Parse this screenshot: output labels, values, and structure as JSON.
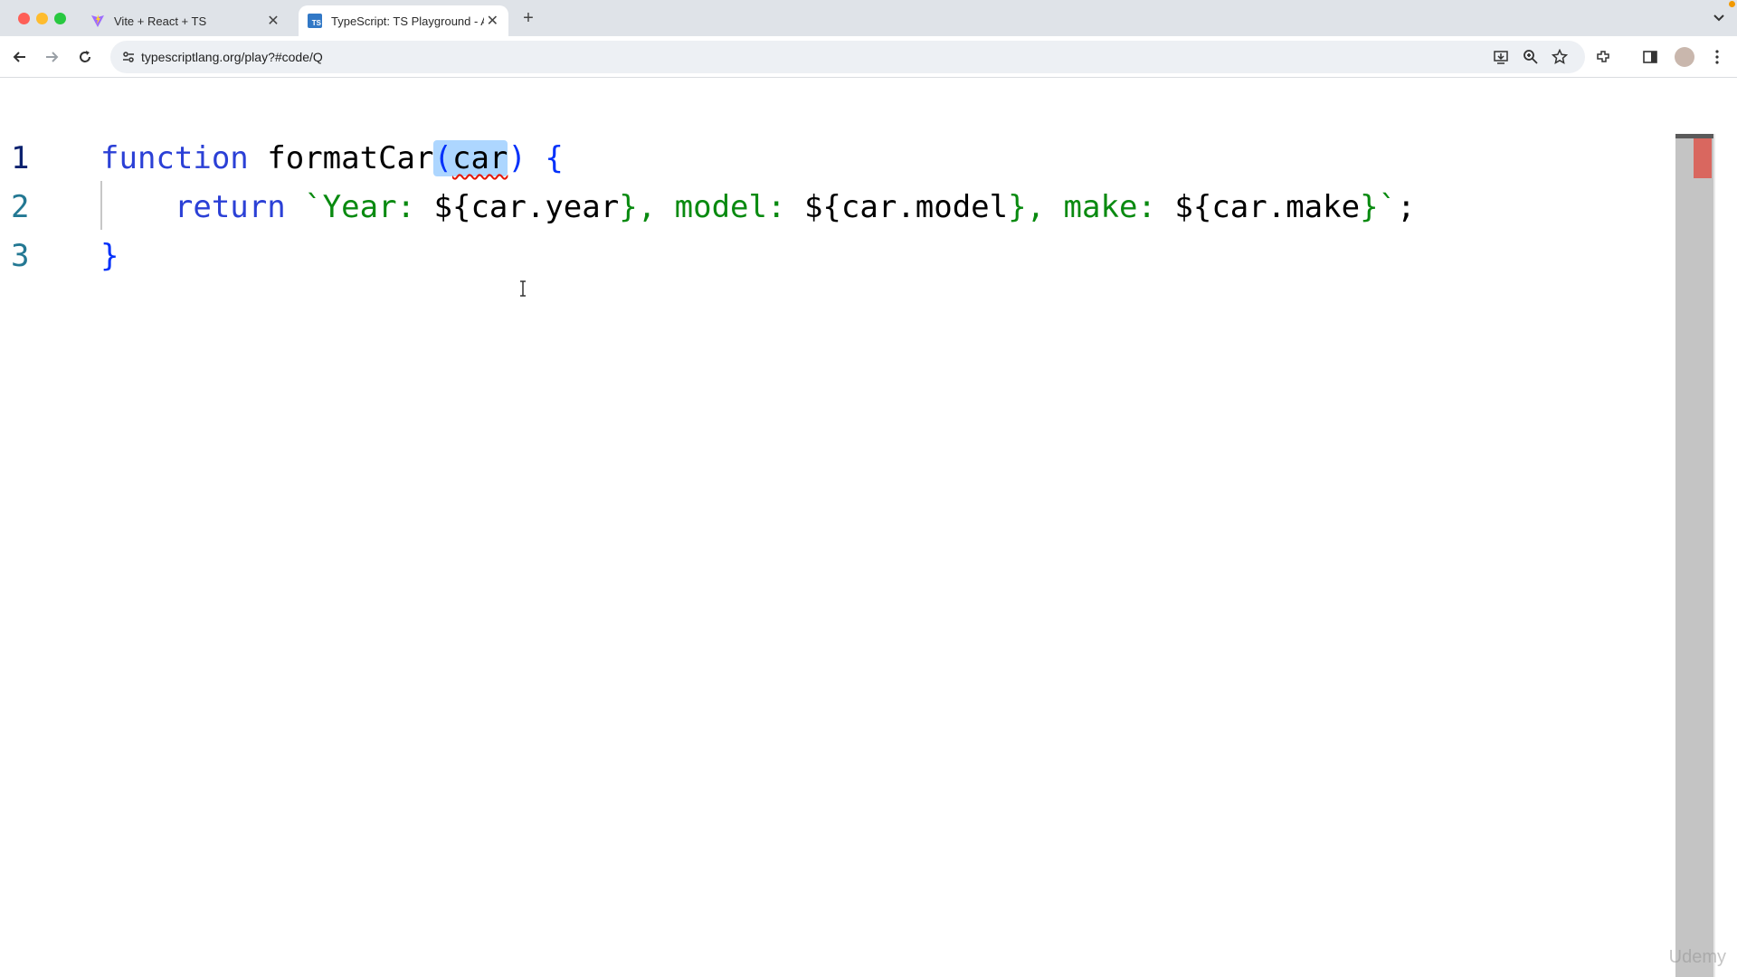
{
  "browser": {
    "tabs": [
      {
        "title": "Vite + React + TS",
        "favicon": "vite-icon",
        "active": false
      },
      {
        "title": "TypeScript: TS Playground - A",
        "favicon": "typescript-icon",
        "active": true
      }
    ],
    "favicon_text": "TS",
    "url": "typescriptlang.org/play?#code/Q"
  },
  "editor": {
    "line_numbers": [
      "1",
      "2",
      "3"
    ],
    "line1": {
      "keyword": "function",
      "name": "formatCar",
      "paren_open": "(",
      "param": "car",
      "paren_close": ")",
      "brace": "{"
    },
    "line2": {
      "keyword": "return",
      "str_open": "`Year: ",
      "d1": "${",
      "e1": "car.year",
      "c1": "}",
      "s2": ", model: ",
      "d2": "${",
      "e2": "car.model",
      "c2": "}",
      "s3": ", make: ",
      "d3": "${",
      "e3": "car.make",
      "c3": "}",
      "str_close": "`",
      "semi": ";"
    },
    "line3": {
      "brace": "}"
    }
  },
  "watermark": "Udemy",
  "colors": {
    "keyword": "#0000ff",
    "string": "#098a10",
    "selection": "#add6ff",
    "error": "#e51400",
    "line_number": "#237893"
  }
}
